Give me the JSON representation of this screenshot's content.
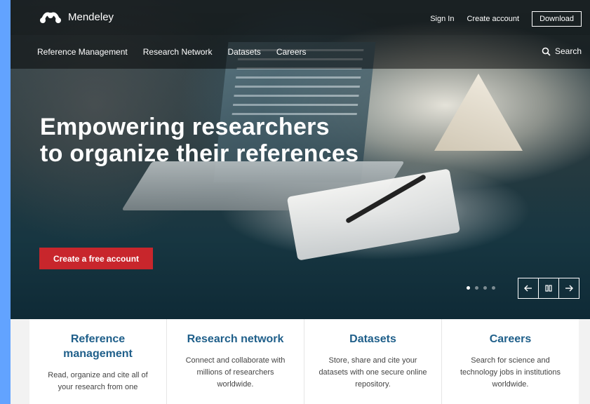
{
  "brand": {
    "name": "Mendeley",
    "logo_icon": "mendeley-logo-icon"
  },
  "topnav": {
    "sign_in": "Sign In",
    "create_account": "Create account",
    "download": "Download"
  },
  "subnav": {
    "items": [
      "Reference Management",
      "Research Network",
      "Datasets",
      "Careers"
    ],
    "search_label": "Search",
    "search_icon": "search-icon"
  },
  "hero": {
    "title_line1": "Empowering researchers",
    "title_line2": "to organize their references",
    "cta_label": "Create a free account"
  },
  "carousel": {
    "slide_count": 4,
    "active_index": 0,
    "prev_icon": "arrow-left-icon",
    "pause_icon": "pause-icon",
    "next_icon": "arrow-right-icon"
  },
  "features": [
    {
      "title": "Reference management",
      "text": "Read, organize and cite all of your research from one"
    },
    {
      "title": "Research network",
      "text": "Connect and collaborate with millions of researchers worldwide."
    },
    {
      "title": "Datasets",
      "text": "Store, share and cite your datasets with one secure online repository."
    },
    {
      "title": "Careers",
      "text": "Search for science and technology jobs in institutions worldwide."
    }
  ],
  "colors": {
    "page_bg": "#62a3ff",
    "cta": "#c8262c",
    "feature_title": "#1f5f8a"
  }
}
